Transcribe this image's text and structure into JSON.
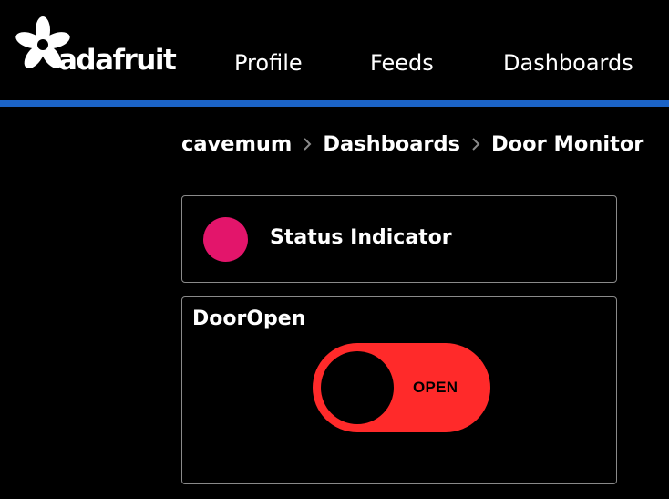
{
  "header": {
    "logo_text": "adafruit",
    "logo_icon": "adafruit-flower-star-logo",
    "nav": [
      {
        "label": "Profile"
      },
      {
        "label": "Feeds"
      },
      {
        "label": "Dashboards"
      }
    ],
    "accent_color": "#1b63c6"
  },
  "breadcrumb": {
    "items": [
      {
        "label": "cavemum"
      },
      {
        "label": "Dashboards"
      },
      {
        "label": "Door Monitor"
      }
    ],
    "separator_icon": "chevron-right-icon"
  },
  "blocks": {
    "status_indicator": {
      "label": "Status Indicator",
      "indicator_color": "#e3156b"
    },
    "toggle": {
      "title": "DoorOpen",
      "state_label": "OPEN",
      "is_on": true,
      "on_color": "#ff2a2a"
    }
  }
}
